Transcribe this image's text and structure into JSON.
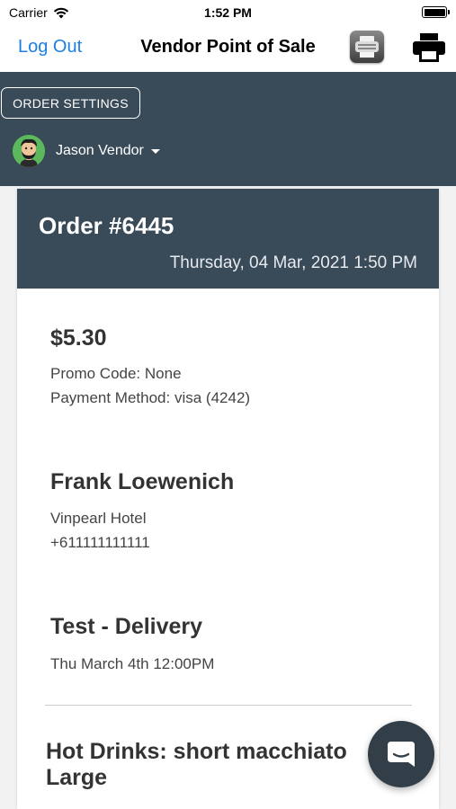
{
  "status_bar": {
    "carrier": "Carrier",
    "time": "1:52 PM"
  },
  "nav": {
    "logout_label": "Log Out",
    "title": "Vendor Point of Sale"
  },
  "vendor": {
    "order_settings_label": "ORDER SETTINGS",
    "name": "Jason Vendor"
  },
  "order": {
    "title": "Order #6445",
    "date": "Thursday, 04 Mar, 2021 1:50 PM",
    "amount": "$5.30",
    "promo": "Promo Code: None",
    "payment": "Payment Method: visa (4242)",
    "customer_name": "Frank Loewenich",
    "address": "Vinpearl Hotel",
    "phone": "+611111111111",
    "delivery_title": "Test - Delivery",
    "delivery_time": "Thu March 4th 12:00PM",
    "item_line1": "Hot Drinks: short macchiato",
    "item_line2": "Large"
  },
  "colors": {
    "header_bg": "#394a58",
    "link_blue": "#1e7fe0",
    "avatar_green": "#5cb85c",
    "chat_bg": "#333f48"
  }
}
